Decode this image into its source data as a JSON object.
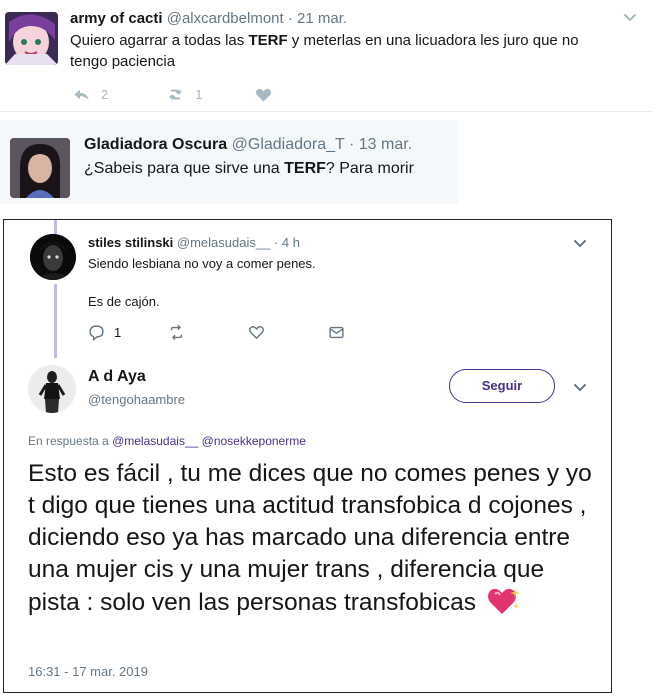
{
  "tweet1": {
    "name": "army of cacti",
    "handle": "@alxcardbelmont",
    "date": "· 21 mar.",
    "text_before": "Quiero agarrar a todas las ",
    "text_bold": "TERF",
    "text_after": " y meterlas en una licuadora les juro que no tengo paciencia",
    "reply_count": "2",
    "retweet_count": "1"
  },
  "tweet2": {
    "name": "Gladiadora Oscura",
    "handle": "@Gladiadora_T",
    "date": "· 13 mar.",
    "text_before": "¿Sabeis para que sirve una ",
    "text_bold": "TERF",
    "text_after": "? Para morir"
  },
  "tweet3": {
    "name": "stiles stilinski",
    "handle": "@melasudais__",
    "date": "· 4 h",
    "line1": "Siendo lesbiana no voy a comer penes.",
    "line2": "Es de cajón.",
    "reply_count": "1"
  },
  "tweet4": {
    "name": "A d Aya",
    "handle": "@tengohaambre",
    "follow_label": "Seguir",
    "reply_prefix": "En respuesta a",
    "reply_user1": "@melasudais__",
    "reply_user2": "@nosekkeponerme",
    "text": "Esto es fácil , tu me dices que no comes penes y yo t digo que tienes una actitud transfobica d cojones , diciendo eso ya has marcado una diferencia entre una mujer cis y una mujer trans , diferencia que pista : solo ven las personas transfobicas",
    "timestamp": "16:31 - 17 mar. 2019"
  },
  "colors": {
    "accent": "#4b2e8f",
    "muted": "#657786",
    "thread_line": "#c7b8dd",
    "quoted_bg": "#f5f8fa"
  },
  "icons": [
    "reply-icon",
    "retweet-icon",
    "like-icon",
    "dm-icon",
    "chevron-down-icon",
    "sparkling-heart-emoji"
  ]
}
